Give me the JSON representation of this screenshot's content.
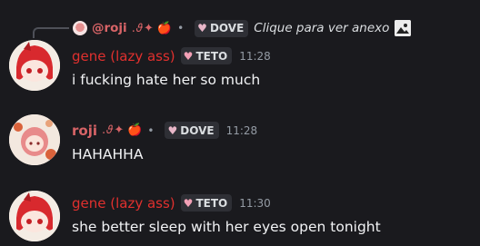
{
  "reply": {
    "username": "@roji",
    "username_deco": ".𝜗✦",
    "tag": "DOVE",
    "text": "Clique para ver anexo"
  },
  "messages": [
    {
      "username": "gene (lazy ass)",
      "name_color": "#e0302e",
      "tag": "TETO",
      "time": "11:28",
      "text": "i fucking hate her so much"
    },
    {
      "username": "roji",
      "username_deco": ".𝜗✦",
      "name_color": "#d86467",
      "tag": "DOVE",
      "time": "11:28",
      "text": "HAHAHHA"
    },
    {
      "username": "gene (lazy ass)",
      "name_color": "#e0302e",
      "tag": "TETO",
      "time": "11:30",
      "text": "she better sleep with her eyes open tonight"
    }
  ]
}
